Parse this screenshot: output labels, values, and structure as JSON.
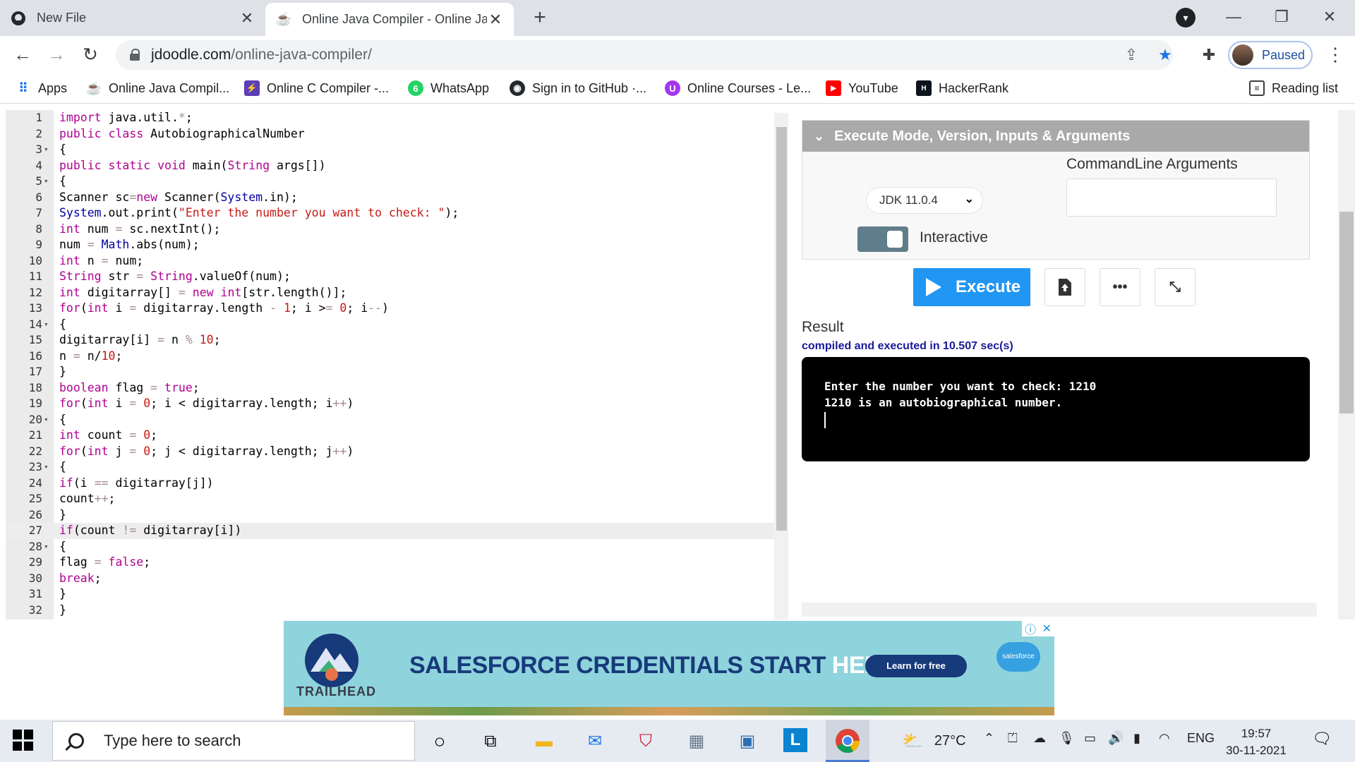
{
  "browser": {
    "tabs": [
      {
        "title": "New File",
        "icon": "github-icon"
      },
      {
        "title": "Online Java Compiler - Online Ja",
        "icon": "jdoodle-icon"
      }
    ],
    "url_host": "jdoodle.com",
    "url_path": "/online-java-compiler/",
    "profile_label": "Paused",
    "bookmarks": [
      {
        "label": "Apps",
        "icon": "apps-grid-icon"
      },
      {
        "label": "Online Java Compil...",
        "icon": "jdoodle-icon"
      },
      {
        "label": "Online C Compiler -...",
        "icon": "bolt-icon"
      },
      {
        "label": "WhatsApp",
        "icon": "whatsapp-icon"
      },
      {
        "label": "Sign in to GitHub ·...",
        "icon": "github-icon"
      },
      {
        "label": "Online Courses - Le...",
        "icon": "udemy-icon"
      },
      {
        "label": "YouTube",
        "icon": "youtube-icon"
      },
      {
        "label": "HackerRank",
        "icon": "hackerrank-icon"
      }
    ],
    "reading_list": "Reading list"
  },
  "editor": {
    "active_line": 27,
    "fold_lines": [
      3,
      5,
      14,
      20,
      23,
      28
    ],
    "lines": [
      "import java.util.*;",
      "public class AutobiographicalNumber",
      "{",
      "public static void main(String args[])",
      "{",
      "Scanner sc=new Scanner(System.in);",
      "System.out.print(\"Enter the number you want to check: \");",
      "int num = sc.nextInt();",
      "num = Math.abs(num);",
      "int n = num;",
      "String str = String.valueOf(num);",
      "int digitarray[] = new int[str.length()];",
      "for(int i = digitarray.length - 1; i >= 0; i--)",
      "{",
      "digitarray[i] = n % 10;",
      "n = n/10;",
      "}",
      "boolean flag = true;",
      "for(int i = 0; i < digitarray.length; i++)",
      "{",
      "int count = 0;",
      "for(int j = 0; j < digitarray.length; j++)",
      "{",
      "if(i == digitarray[j])",
      "count++;",
      "}",
      "if(count != digitarray[i])",
      "{",
      "flag = false;",
      "break;",
      "}",
      "}"
    ]
  },
  "panel": {
    "section_title": "Execute Mode, Version, Inputs & Arguments",
    "jdk_version": "JDK 11.0.4",
    "cmd_args_label": "CommandLine Arguments",
    "cmd_args_value": "",
    "interactive_label": "Interactive",
    "interactive_on": true,
    "execute_label": "Execute",
    "more_label": "•••",
    "result_label": "Result",
    "exec_info": "compiled and executed in 10.507 sec(s)",
    "output_lines": [
      "Enter the number you want to check: 1210",
      "1210 is an autobiographical number."
    ]
  },
  "ad": {
    "brand": "TRAILHEAD",
    "headline_main": "SALESFORCE CREDENTIALS START ",
    "headline_highlight": "HERE.",
    "cta": "Learn for free",
    "sponsor": "salesforce"
  },
  "taskbar": {
    "search_placeholder": "Type here to search",
    "temperature": "27°C",
    "language": "ENG",
    "time": "19:57",
    "date": "30-11-2021"
  },
  "colors": {
    "keyword": "#b00090",
    "string": "#c41a16",
    "execute_button": "#2196f3",
    "terminal_bg": "#000000",
    "section_header": "#a9a9a9"
  }
}
